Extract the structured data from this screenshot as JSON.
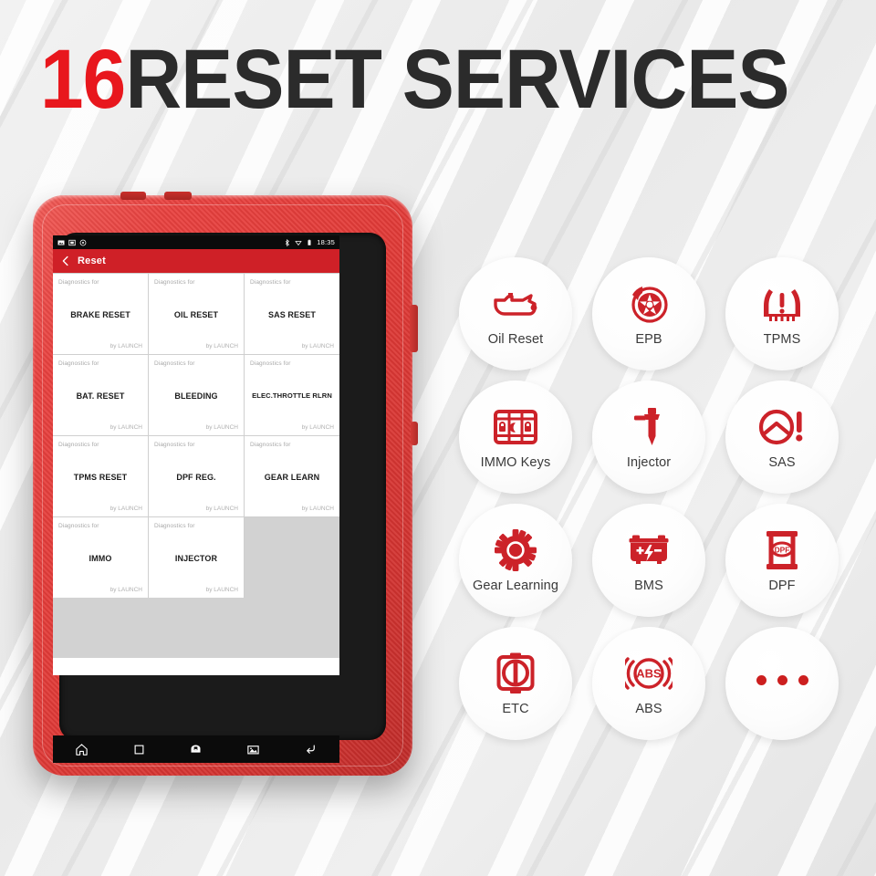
{
  "headline": {
    "count": "16",
    "text": "RESET SERVICES"
  },
  "colors": {
    "brand_red": "#cf2027",
    "icon_red": "#cc2229",
    "headline_dark": "#2b2b2b",
    "device_red": "#e23b38"
  },
  "device": {
    "status_bar": {
      "left_icons": [
        "image-icon",
        "screenshot-icon",
        "settings-icon"
      ],
      "right_icons": [
        "bluetooth-icon",
        "wifi-icon",
        "battery-icon"
      ],
      "time": "18:35"
    },
    "app_bar": {
      "back_icon": "chevron-left-icon",
      "title": "Reset"
    },
    "cell_prefix": "Diagnostics for",
    "cell_suffix": "by LAUNCH",
    "functions": [
      "BRAKE RESET",
      "OIL RESET",
      "SAS RESET",
      "BAT. RESET",
      "BLEEDING",
      "ELEC.THROTTLE RLRN",
      "TPMS RESET",
      "DPF REG.",
      "GEAR LEARN",
      "IMMO",
      "INJECTOR"
    ],
    "nav_bar": [
      "home-icon",
      "recents-icon",
      "vci-icon",
      "screenshot-icon",
      "back-icon"
    ]
  },
  "services": [
    {
      "label": "Oil Reset",
      "icon": "oil-can-icon"
    },
    {
      "label": "EPB",
      "icon": "brake-disc-icon"
    },
    {
      "label": "TPMS",
      "icon": "tire-pressure-icon"
    },
    {
      "label": "IMMO Keys",
      "icon": "immo-keys-icon"
    },
    {
      "label": "Injector",
      "icon": "injector-icon"
    },
    {
      "label": "SAS",
      "icon": "steering-angle-icon"
    },
    {
      "label": "Gear Learning",
      "icon": "gear-icon"
    },
    {
      "label": "BMS",
      "icon": "battery-icon"
    },
    {
      "label": "DPF",
      "icon": "dpf-filter-icon"
    },
    {
      "label": "ETC",
      "icon": "throttle-body-icon"
    },
    {
      "label": "ABS",
      "icon": "abs-icon"
    },
    {
      "label": "",
      "icon": "more-dots-icon"
    }
  ]
}
